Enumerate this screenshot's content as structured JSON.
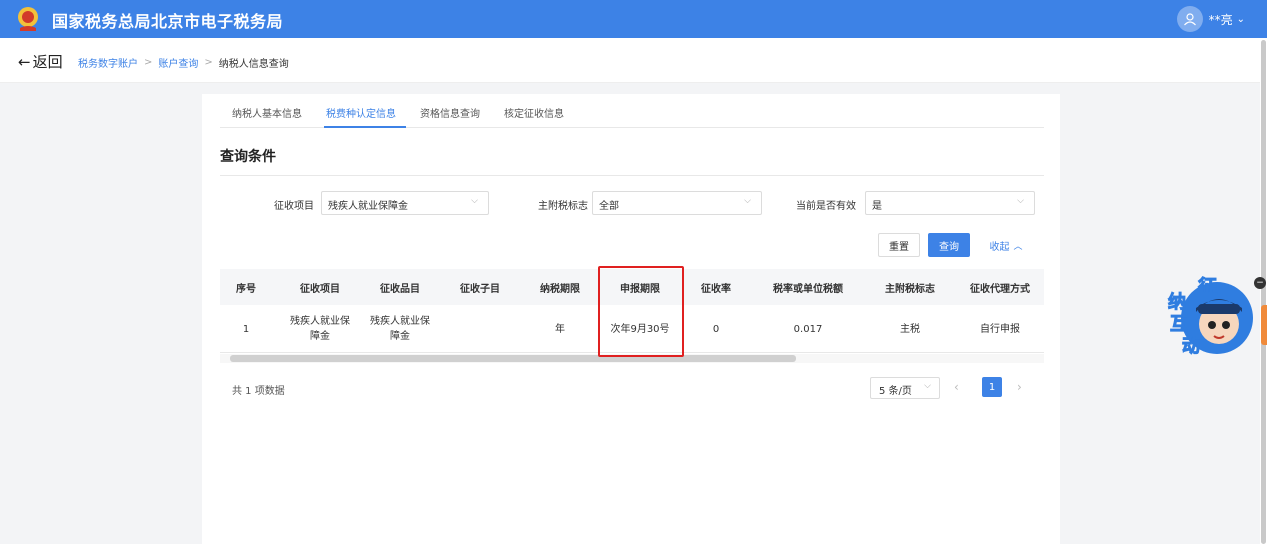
{
  "header": {
    "site_title": "国家税务总局北京市电子税务局",
    "user_name": "**亮",
    "accent_color": "#3d82e6"
  },
  "nav": {
    "back_label": "返回",
    "breadcrumb": [
      "税务数字账户",
      "账户查询",
      "纳税人信息查询"
    ]
  },
  "tabs": [
    {
      "label": "纳税人基本信息",
      "active": false
    },
    {
      "label": "税费种认定信息",
      "active": true
    },
    {
      "label": "资格信息查询",
      "active": false
    },
    {
      "label": "核定征收信息",
      "active": false
    }
  ],
  "query": {
    "section_title": "查询条件",
    "fields": [
      {
        "label": "征收项目",
        "value": "残疾人就业保障金"
      },
      {
        "label": "主附税标志",
        "value": "全部"
      },
      {
        "label": "当前是否有效",
        "value": "是"
      }
    ],
    "reset_label": "重置",
    "query_label": "查询",
    "collapse_label": "收起"
  },
  "table": {
    "columns": [
      "序号",
      "征收项目",
      "征收品目",
      "征收子目",
      "纳税期限",
      "申报期限",
      "征收率",
      "税率或单位税额",
      "主附税标志",
      "征收代理方式"
    ],
    "rows": [
      {
        "index": "1",
        "item_line1": "残疾人就业保",
        "item_line2": "障金",
        "category_line1": "残疾人就业保",
        "category_line2": "障金",
        "subitem": "",
        "period": "年",
        "deadline": "次年9月30号",
        "rate": "0",
        "tax_rate": "0.017",
        "main_flag": "主税",
        "agent_method": "自行申报"
      }
    ],
    "highlight_color": "#e02020"
  },
  "pagination": {
    "total_text": "共 1 项数据",
    "page_size": "5 条/页",
    "current_page": "1"
  },
  "assistant": {
    "line1": "征",
    "line2": "纳",
    "line3": "互",
    "line4": "动"
  }
}
